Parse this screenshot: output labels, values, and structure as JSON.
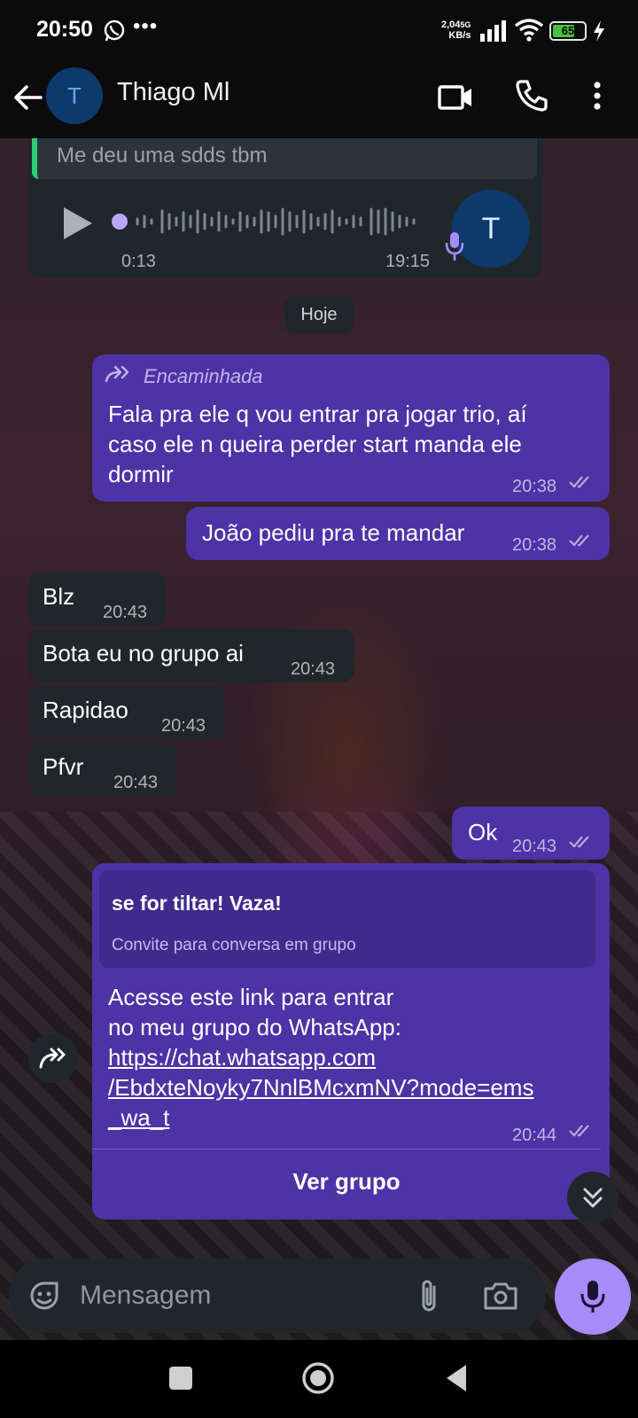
{
  "status_bar": {
    "time": "20:50",
    "overflow": "•••",
    "net_speed": "2,04",
    "net_unit": "KB/s",
    "network": "5G",
    "battery": "65"
  },
  "header": {
    "avatar_letter": "T",
    "contact_name": "Thiago Ml"
  },
  "chat": {
    "voice_message": {
      "quoted_text": "Me deu uma sdds tbm",
      "duration": "0:13",
      "time": "19:15",
      "avatar_letter": "T"
    },
    "date_divider": "Hoje",
    "messages": [
      {
        "dir": "out",
        "forwarded_label": "Encaminhada",
        "text": "Fala pra ele q vou entrar pra jogar trio, aí caso ele n queira perder start manda ele dormir",
        "time": "20:38"
      },
      {
        "dir": "out",
        "text": "João pediu pra te mandar",
        "time": "20:38"
      },
      {
        "dir": "in",
        "text": "Blz",
        "time": "20:43"
      },
      {
        "dir": "in",
        "text": "Bota eu no grupo ai",
        "time": "20:43"
      },
      {
        "dir": "in",
        "text": "Rapidao",
        "time": "20:43"
      },
      {
        "dir": "in",
        "text": "Pfvr",
        "time": "20:43"
      },
      {
        "dir": "out",
        "text": "Ok",
        "time": "20:43"
      }
    ],
    "invite": {
      "group_name": "se for tiltar! Vaza!",
      "subtitle": "Convite para conversa em grupo",
      "body_line1": "Acesse este link para entrar",
      "body_line2": "no meu grupo do WhatsApp:",
      "link_line1": "https://chat.whatsapp.com",
      "link_line2": "/EbdxteNoyky7NnlBMcxmNV?mode=ems",
      "link_line3": "_wa_t",
      "time": "20:44",
      "button": "Ver grupo"
    }
  },
  "composer": {
    "placeholder": "Mensagem"
  },
  "colors": {
    "outgoing_bubble": "#4c33a6",
    "incoming_bubble": "#20272b",
    "mic_button": "#a78bfa",
    "quote_bar": "#2ecc71"
  },
  "icons": [
    "whatsapp-icon",
    "signal-icon",
    "wifi-icon",
    "battery-icon",
    "charging-icon",
    "back-arrow-icon",
    "video-call-icon",
    "voice-call-icon",
    "more-options-icon",
    "play-icon",
    "microphone-icon",
    "forward-icon",
    "read-receipt-icon",
    "share-icon",
    "chevron-double-down-icon",
    "emoji-icon",
    "attachment-icon",
    "camera-icon",
    "nav-recents-icon",
    "nav-home-icon",
    "nav-back-icon"
  ]
}
